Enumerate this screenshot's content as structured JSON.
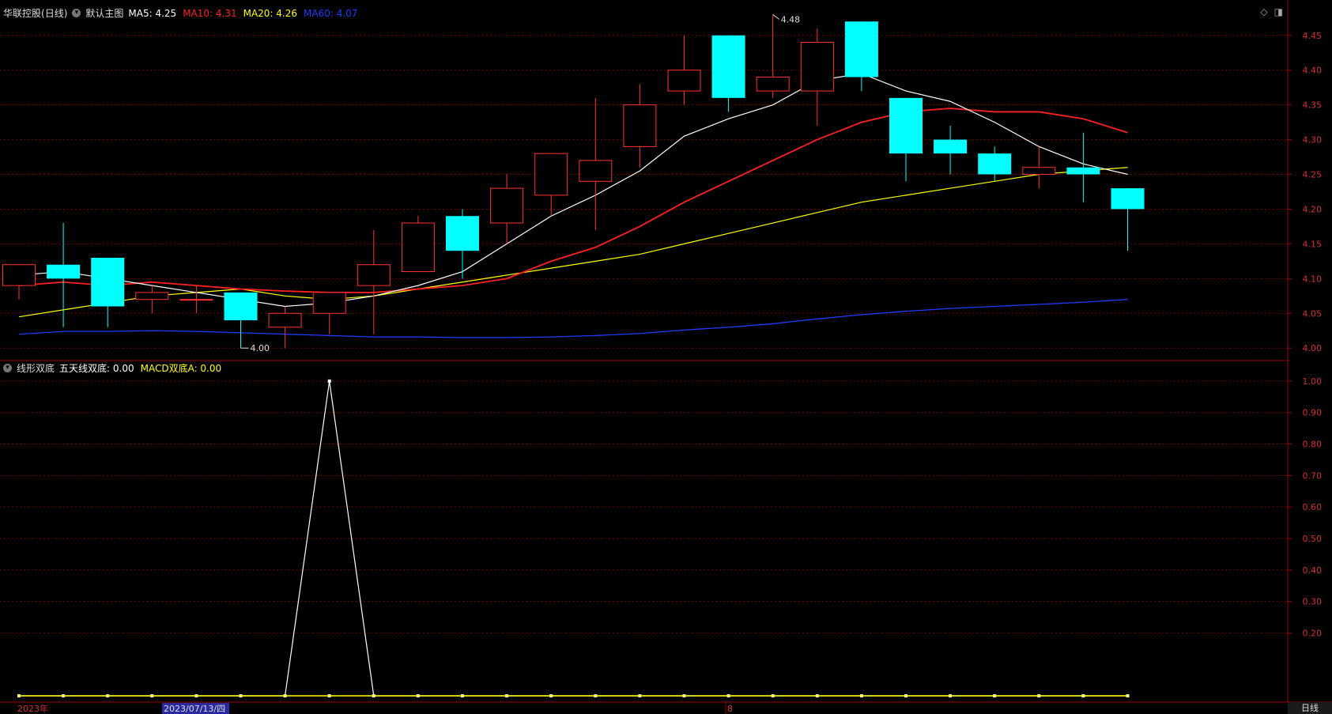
{
  "main_panel": {
    "stock_name": "华联控股",
    "period": "(日线)",
    "template_label": "默认主图",
    "indicators": [
      {
        "label": "MA5: 4.25",
        "color": "#ffffff"
      },
      {
        "label": "MA10: 4.31",
        "color": "#ff2020"
      },
      {
        "label": "MA20: 4.26",
        "color": "#ffff00"
      },
      {
        "label": "MA60: 4.07",
        "color": "#1e3cff"
      }
    ],
    "high_label": "4.48",
    "low_label": "4.00",
    "y_axis_ticks": [
      "4.45",
      "4.40",
      "4.35",
      "4.30",
      "4.25",
      "4.20",
      "4.15",
      "4.10",
      "4.05",
      "4.00"
    ]
  },
  "sub_panel": {
    "title": "线形双底",
    "indicators": [
      {
        "label": "五天线双底: 0.00",
        "color": "#ffffff"
      },
      {
        "label": "MACD双底A: 0.00",
        "color": "#ffff00"
      }
    ],
    "y_axis_ticks": [
      "1.00",
      "0.90",
      "0.80",
      "0.70",
      "0.60",
      "0.50",
      "0.40",
      "0.30",
      "0.20"
    ]
  },
  "x_axis": {
    "year_label": "2023年",
    "cursor_date": "2023/07/13/四",
    "month_label": "8"
  },
  "period_button": "日线",
  "colors": {
    "up": "#ff3232",
    "down": "#00ffff",
    "grid": "#7a0000",
    "axis": "#a00000"
  },
  "chart_data": {
    "type": "candlestick",
    "candles": [
      {
        "o": 4.09,
        "c": 4.12,
        "h": 4.12,
        "l": 4.07
      },
      {
        "o": 4.12,
        "c": 4.1,
        "h": 4.18,
        "l": 4.03
      },
      {
        "o": 4.13,
        "c": 4.06,
        "h": 4.13,
        "l": 4.03
      },
      {
        "o": 4.07,
        "c": 4.08,
        "h": 4.09,
        "l": 4.05
      },
      {
        "o": 4.07,
        "c": 4.07,
        "h": 4.09,
        "l": 4.05
      },
      {
        "o": 4.08,
        "c": 4.04,
        "h": 4.08,
        "l": 4.0
      },
      {
        "o": 4.03,
        "c": 4.05,
        "h": 4.06,
        "l": 4.0
      },
      {
        "o": 4.05,
        "c": 4.08,
        "h": 4.08,
        "l": 4.02
      },
      {
        "o": 4.09,
        "c": 4.12,
        "h": 4.17,
        "l": 4.02
      },
      {
        "o": 4.11,
        "c": 4.18,
        "h": 4.19,
        "l": 4.11
      },
      {
        "o": 4.19,
        "c": 4.14,
        "h": 4.2,
        "l": 4.1
      },
      {
        "o": 4.18,
        "c": 4.23,
        "h": 4.25,
        "l": 4.15
      },
      {
        "o": 4.22,
        "c": 4.28,
        "h": 4.28,
        "l": 4.19
      },
      {
        "o": 4.24,
        "c": 4.27,
        "h": 4.36,
        "l": 4.17
      },
      {
        "o": 4.29,
        "c": 4.35,
        "h": 4.38,
        "l": 4.26
      },
      {
        "o": 4.37,
        "c": 4.4,
        "h": 4.45,
        "l": 4.35
      },
      {
        "o": 4.45,
        "c": 4.36,
        "h": 4.45,
        "l": 4.34
      },
      {
        "o": 4.37,
        "c": 4.39,
        "h": 4.48,
        "l": 4.36
      },
      {
        "o": 4.37,
        "c": 4.44,
        "h": 4.46,
        "l": 4.32
      },
      {
        "o": 4.47,
        "c": 4.39,
        "h": 4.47,
        "l": 4.37
      },
      {
        "o": 4.36,
        "c": 4.28,
        "h": 4.36,
        "l": 4.24
      },
      {
        "o": 4.3,
        "c": 4.28,
        "h": 4.32,
        "l": 4.25
      },
      {
        "o": 4.28,
        "c": 4.25,
        "h": 4.29,
        "l": 4.24
      },
      {
        "o": 4.25,
        "c": 4.26,
        "h": 4.29,
        "l": 4.23
      },
      {
        "o": 4.26,
        "c": 4.25,
        "h": 4.31,
        "l": 4.21
      },
      {
        "o": 4.23,
        "c": 4.2,
        "h": 4.23,
        "l": 4.14
      }
    ],
    "ma5": [
      4.105,
      4.11,
      4.1,
      4.09,
      4.08,
      4.07,
      4.06,
      4.065,
      4.075,
      4.09,
      4.11,
      4.15,
      4.19,
      4.22,
      4.255,
      4.305,
      4.33,
      4.35,
      4.385,
      4.395,
      4.37,
      4.355,
      4.325,
      4.29,
      4.265,
      4.25
    ],
    "ma10": [
      4.09,
      4.095,
      4.09,
      4.095,
      4.09,
      4.085,
      4.082,
      4.08,
      4.08,
      4.085,
      4.09,
      4.1,
      4.125,
      4.145,
      4.175,
      4.21,
      4.24,
      4.27,
      4.3,
      4.325,
      4.34,
      4.345,
      4.34,
      4.34,
      4.33,
      4.31
    ],
    "ma20": [
      4.045,
      4.055,
      4.065,
      4.075,
      4.08,
      4.085,
      4.075,
      4.07,
      4.075,
      4.085,
      4.095,
      4.105,
      4.115,
      4.125,
      4.135,
      4.15,
      4.165,
      4.18,
      4.195,
      4.21,
      4.22,
      4.23,
      4.24,
      4.25,
      4.255,
      4.26
    ],
    "ma60": [
      4.02,
      4.024,
      4.024,
      4.025,
      4.024,
      4.022,
      4.02,
      4.018,
      4.016,
      4.016,
      4.015,
      4.015,
      4.016,
      4.018,
      4.021,
      4.026,
      4.03,
      4.035,
      4.042,
      4.048,
      4.053,
      4.057,
      4.06,
      4.063,
      4.066,
      4.07
    ],
    "sub_white": [
      0,
      0,
      0,
      0,
      0,
      0,
      0,
      1,
      0,
      0,
      0,
      0,
      0,
      0,
      0,
      0,
      0,
      0,
      0,
      0,
      0,
      0,
      0,
      0,
      0,
      0
    ],
    "sub_yellow": [
      0,
      0,
      0,
      0,
      0,
      0,
      0,
      0,
      0,
      0,
      0,
      0,
      0,
      0,
      0,
      0,
      0,
      0,
      0,
      0,
      0,
      0,
      0,
      0,
      0,
      0
    ],
    "main_ylim": [
      3.99,
      4.485
    ],
    "sub_ylim": [
      0,
      1.03
    ]
  }
}
